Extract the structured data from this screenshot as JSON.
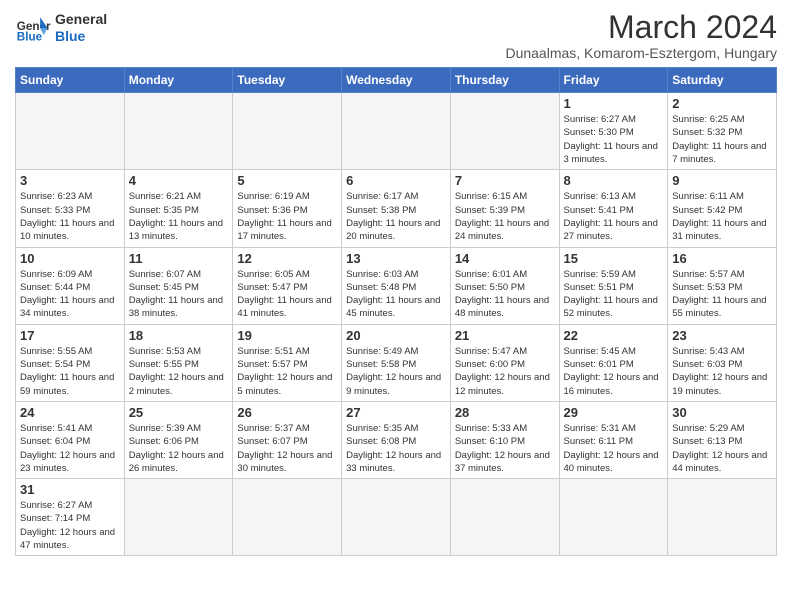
{
  "header": {
    "logo_general": "General",
    "logo_blue": "Blue",
    "month_year": "March 2024",
    "location": "Dunaalmas, Komarom-Esztergom, Hungary"
  },
  "weekdays": [
    "Sunday",
    "Monday",
    "Tuesday",
    "Wednesday",
    "Thursday",
    "Friday",
    "Saturday"
  ],
  "weeks": [
    [
      {
        "day": "",
        "info": ""
      },
      {
        "day": "",
        "info": ""
      },
      {
        "day": "",
        "info": ""
      },
      {
        "day": "",
        "info": ""
      },
      {
        "day": "",
        "info": ""
      },
      {
        "day": "1",
        "info": "Sunrise: 6:27 AM\nSunset: 5:30 PM\nDaylight: 11 hours\nand 3 minutes."
      },
      {
        "day": "2",
        "info": "Sunrise: 6:25 AM\nSunset: 5:32 PM\nDaylight: 11 hours\nand 7 minutes."
      }
    ],
    [
      {
        "day": "3",
        "info": "Sunrise: 6:23 AM\nSunset: 5:33 PM\nDaylight: 11 hours\nand 10 minutes."
      },
      {
        "day": "4",
        "info": "Sunrise: 6:21 AM\nSunset: 5:35 PM\nDaylight: 11 hours\nand 13 minutes."
      },
      {
        "day": "5",
        "info": "Sunrise: 6:19 AM\nSunset: 5:36 PM\nDaylight: 11 hours\nand 17 minutes."
      },
      {
        "day": "6",
        "info": "Sunrise: 6:17 AM\nSunset: 5:38 PM\nDaylight: 11 hours\nand 20 minutes."
      },
      {
        "day": "7",
        "info": "Sunrise: 6:15 AM\nSunset: 5:39 PM\nDaylight: 11 hours\nand 24 minutes."
      },
      {
        "day": "8",
        "info": "Sunrise: 6:13 AM\nSunset: 5:41 PM\nDaylight: 11 hours\nand 27 minutes."
      },
      {
        "day": "9",
        "info": "Sunrise: 6:11 AM\nSunset: 5:42 PM\nDaylight: 11 hours\nand 31 minutes."
      }
    ],
    [
      {
        "day": "10",
        "info": "Sunrise: 6:09 AM\nSunset: 5:44 PM\nDaylight: 11 hours\nand 34 minutes."
      },
      {
        "day": "11",
        "info": "Sunrise: 6:07 AM\nSunset: 5:45 PM\nDaylight: 11 hours\nand 38 minutes."
      },
      {
        "day": "12",
        "info": "Sunrise: 6:05 AM\nSunset: 5:47 PM\nDaylight: 11 hours\nand 41 minutes."
      },
      {
        "day": "13",
        "info": "Sunrise: 6:03 AM\nSunset: 5:48 PM\nDaylight: 11 hours\nand 45 minutes."
      },
      {
        "day": "14",
        "info": "Sunrise: 6:01 AM\nSunset: 5:50 PM\nDaylight: 11 hours\nand 48 minutes."
      },
      {
        "day": "15",
        "info": "Sunrise: 5:59 AM\nSunset: 5:51 PM\nDaylight: 11 hours\nand 52 minutes."
      },
      {
        "day": "16",
        "info": "Sunrise: 5:57 AM\nSunset: 5:53 PM\nDaylight: 11 hours\nand 55 minutes."
      }
    ],
    [
      {
        "day": "17",
        "info": "Sunrise: 5:55 AM\nSunset: 5:54 PM\nDaylight: 11 hours\nand 59 minutes."
      },
      {
        "day": "18",
        "info": "Sunrise: 5:53 AM\nSunset: 5:55 PM\nDaylight: 12 hours\nand 2 minutes."
      },
      {
        "day": "19",
        "info": "Sunrise: 5:51 AM\nSunset: 5:57 PM\nDaylight: 12 hours\nand 5 minutes."
      },
      {
        "day": "20",
        "info": "Sunrise: 5:49 AM\nSunset: 5:58 PM\nDaylight: 12 hours\nand 9 minutes."
      },
      {
        "day": "21",
        "info": "Sunrise: 5:47 AM\nSunset: 6:00 PM\nDaylight: 12 hours\nand 12 minutes."
      },
      {
        "day": "22",
        "info": "Sunrise: 5:45 AM\nSunset: 6:01 PM\nDaylight: 12 hours\nand 16 minutes."
      },
      {
        "day": "23",
        "info": "Sunrise: 5:43 AM\nSunset: 6:03 PM\nDaylight: 12 hours\nand 19 minutes."
      }
    ],
    [
      {
        "day": "24",
        "info": "Sunrise: 5:41 AM\nSunset: 6:04 PM\nDaylight: 12 hours\nand 23 minutes."
      },
      {
        "day": "25",
        "info": "Sunrise: 5:39 AM\nSunset: 6:06 PM\nDaylight: 12 hours\nand 26 minutes."
      },
      {
        "day": "26",
        "info": "Sunrise: 5:37 AM\nSunset: 6:07 PM\nDaylight: 12 hours\nand 30 minutes."
      },
      {
        "day": "27",
        "info": "Sunrise: 5:35 AM\nSunset: 6:08 PM\nDaylight: 12 hours\nand 33 minutes."
      },
      {
        "day": "28",
        "info": "Sunrise: 5:33 AM\nSunset: 6:10 PM\nDaylight: 12 hours\nand 37 minutes."
      },
      {
        "day": "29",
        "info": "Sunrise: 5:31 AM\nSunset: 6:11 PM\nDaylight: 12 hours\nand 40 minutes."
      },
      {
        "day": "30",
        "info": "Sunrise: 5:29 AM\nSunset: 6:13 PM\nDaylight: 12 hours\nand 44 minutes."
      }
    ],
    [
      {
        "day": "31",
        "info": "Sunrise: 6:27 AM\nSunset: 7:14 PM\nDaylight: 12 hours\nand 47 minutes."
      },
      {
        "day": "",
        "info": ""
      },
      {
        "day": "",
        "info": ""
      },
      {
        "day": "",
        "info": ""
      },
      {
        "day": "",
        "info": ""
      },
      {
        "day": "",
        "info": ""
      },
      {
        "day": "",
        "info": ""
      }
    ]
  ]
}
